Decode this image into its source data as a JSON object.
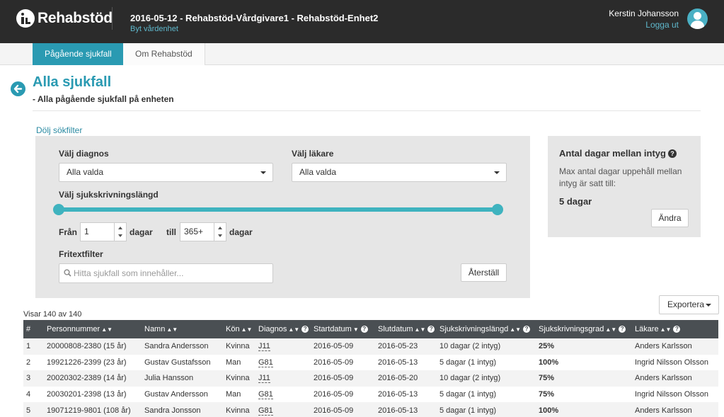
{
  "header": {
    "logo_text": "Rehabstöd",
    "unit_title": "2016-05-12 - Rehabstöd-Vårdgivare1 - Rehabstöd-Enhet2",
    "change_unit": "Byt vårdenhet",
    "user_name": "Kerstin Johansson",
    "logout": "Logga ut"
  },
  "tabs": [
    {
      "label": "Pågående sjukfall",
      "active": true
    },
    {
      "label": "Om Rehabstöd",
      "active": false
    }
  ],
  "page": {
    "title": "Alla sjukfall",
    "subtitle": "- Alla pågående sjukfall på enheten",
    "hide_filter": "Dölj sökfilter"
  },
  "filter": {
    "diagnosis_label": "Välj diagnos",
    "diagnosis_value": "Alla valda",
    "doctor_label": "Välj läkare",
    "doctor_value": "Alla valda",
    "length_label": "Välj sjukskrivningslängd",
    "from_label": "Från",
    "from_value": "1",
    "days_label": "dagar",
    "to_label": "till",
    "to_value": "365+",
    "freetext_label": "Fritextfilter",
    "search_placeholder": "Hitta sjukfall som innehåller...",
    "reset_label": "Återställ",
    "slider_range": [
      1,
      365
    ]
  },
  "info": {
    "title": "Antal dagar mellan intyg",
    "text": "Max antal dagar uppehåll mellan intyg är satt till:",
    "value": "5 dagar",
    "change_label": "Ändra"
  },
  "table": {
    "count_text": "Visar 140 av 140",
    "export_label": "Exportera",
    "columns": [
      "#",
      "Personnummer",
      "Namn",
      "Kön",
      "Diagnos",
      "Startdatum",
      "Slutdatum",
      "Sjukskrivningslängd",
      "Sjukskrivningsgrad",
      "Läkare"
    ],
    "rows": [
      [
        "1",
        "20000808-2380 (15 år)",
        "Sandra Andersson",
        "Kvinna",
        "J11",
        "2016-05-09",
        "2016-05-23",
        "10 dagar (2 intyg)",
        "25%",
        "Anders Karlsson"
      ],
      [
        "2",
        "19921226-2399 (23 år)",
        "Gustav Gustafsson",
        "Man",
        "G81",
        "2016-05-09",
        "2016-05-13",
        "5 dagar (1 intyg)",
        "100%",
        "Ingrid Nilsson Olsson"
      ],
      [
        "3",
        "20020302-2389 (14 år)",
        "Julia Hansson",
        "Kvinna",
        "J11",
        "2016-05-09",
        "2016-05-20",
        "10 dagar (2 intyg)",
        "75%",
        "Anders Karlsson"
      ],
      [
        "4",
        "20030201-2398 (13 år)",
        "Gustav Andersson",
        "Man",
        "G81",
        "2016-05-09",
        "2016-05-13",
        "5 dagar (1 intyg)",
        "75%",
        "Ingrid Nilsson Olsson"
      ],
      [
        "5",
        "19071219-9801 (108 år)",
        "Sandra Jonsson",
        "Kvinna",
        "G81",
        "2016-05-09",
        "2016-05-13",
        "5 dagar (1 intyg)",
        "100%",
        "Anders Karlsson"
      ]
    ]
  },
  "colors": {
    "accent": "#2a9ab2",
    "header_bg": "#2b2b2b",
    "slider": "#3fb3bf",
    "table_header": "#4a4f53"
  }
}
